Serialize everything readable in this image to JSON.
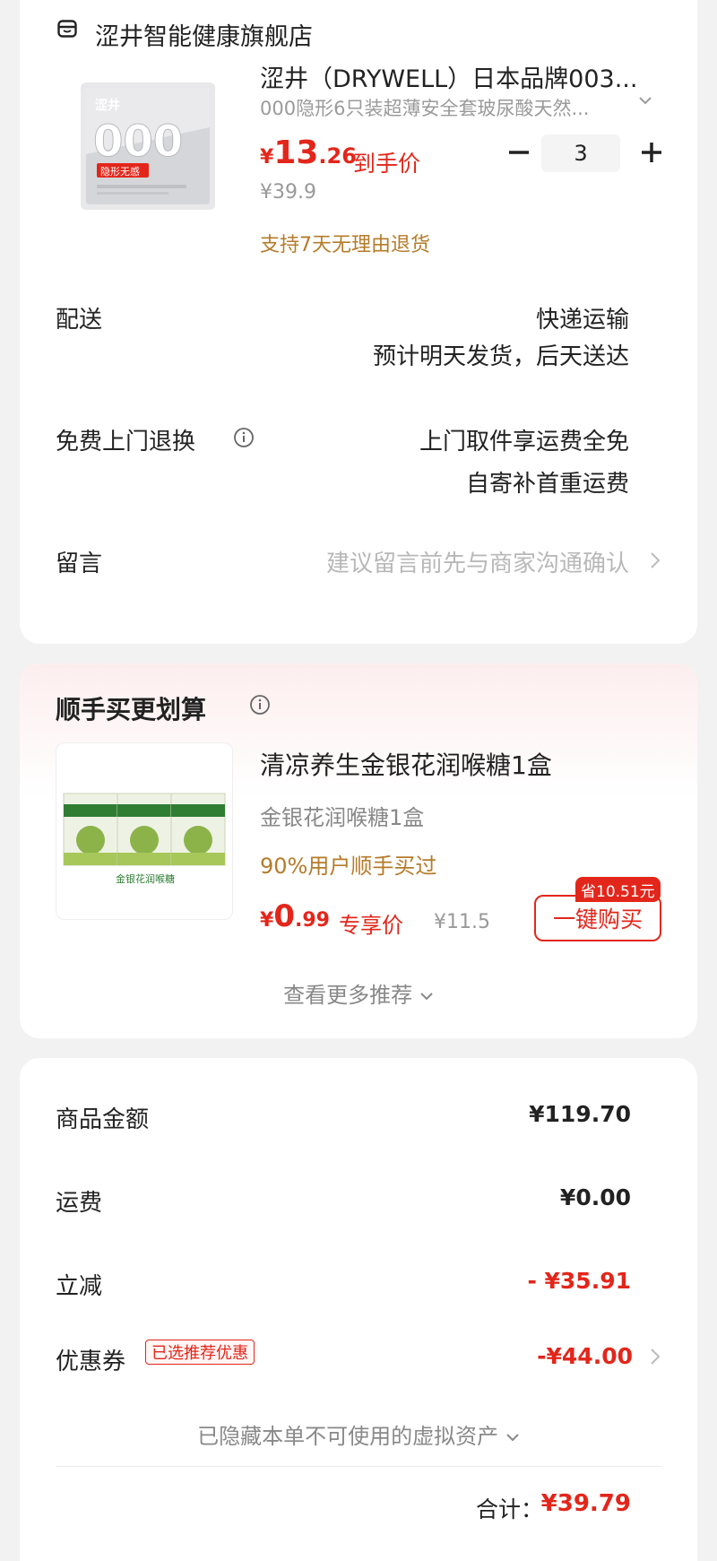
{
  "store": {
    "name": "涩井智能健康旗舰店",
    "icon": "store-icon"
  },
  "product": {
    "title": "涩井（DRYWELL）日本品牌003...",
    "spec": "000隐形6只装超薄安全套玻尿酸天然...",
    "price_currency": "¥",
    "price_int": "13",
    "price_dec": ".26",
    "price_tag": "到手价",
    "original_price": "¥39.9",
    "promise": "支持7天无理由退货",
    "quantity": "3",
    "image_brand": "涩井",
    "image_big": "000",
    "image_badge": "隐形无感"
  },
  "delivery": {
    "label": "配送",
    "method": "快递运输",
    "eta": "预计明天发货，后天送达"
  },
  "returns": {
    "label": "免费上门退换",
    "line1": "上门取件享运费全免",
    "line2": "自寄补首重运费"
  },
  "message": {
    "label": "留言",
    "placeholder": "建议留言前先与商家沟通确认"
  },
  "addon": {
    "section_title": "顺手买更划算",
    "name": "清凉养生金银花润喉糖1盒",
    "spec": "金银花润喉糖1盒",
    "social": "90%用户顺手买过",
    "price_currency": "¥",
    "price_int": "0",
    "price_dec": ".99",
    "price_tag": "专享价",
    "original_price": "¥11.5",
    "save_badge": "省10.51元",
    "buy_button": "一键购买",
    "more": "查看更多推荐",
    "image_label": "金银花润喉糖"
  },
  "summary": {
    "goods_label": "商品金额",
    "goods_value": "¥119.70",
    "shipping_label": "运费",
    "shipping_value": "¥0.00",
    "discount_label": "立减",
    "discount_value": "- ¥35.91",
    "coupon_label": "优惠券",
    "coupon_tag": "已选推荐优惠",
    "coupon_value": "-¥44.00",
    "hidden_assets": "已隐藏本单不可使用的虚拟资产",
    "total_label": "合计：",
    "total_value": "¥39.79"
  },
  "colors": {
    "accent_red": "#e3261b",
    "gold": "#b57b2a",
    "background": "#f2f2f2"
  }
}
